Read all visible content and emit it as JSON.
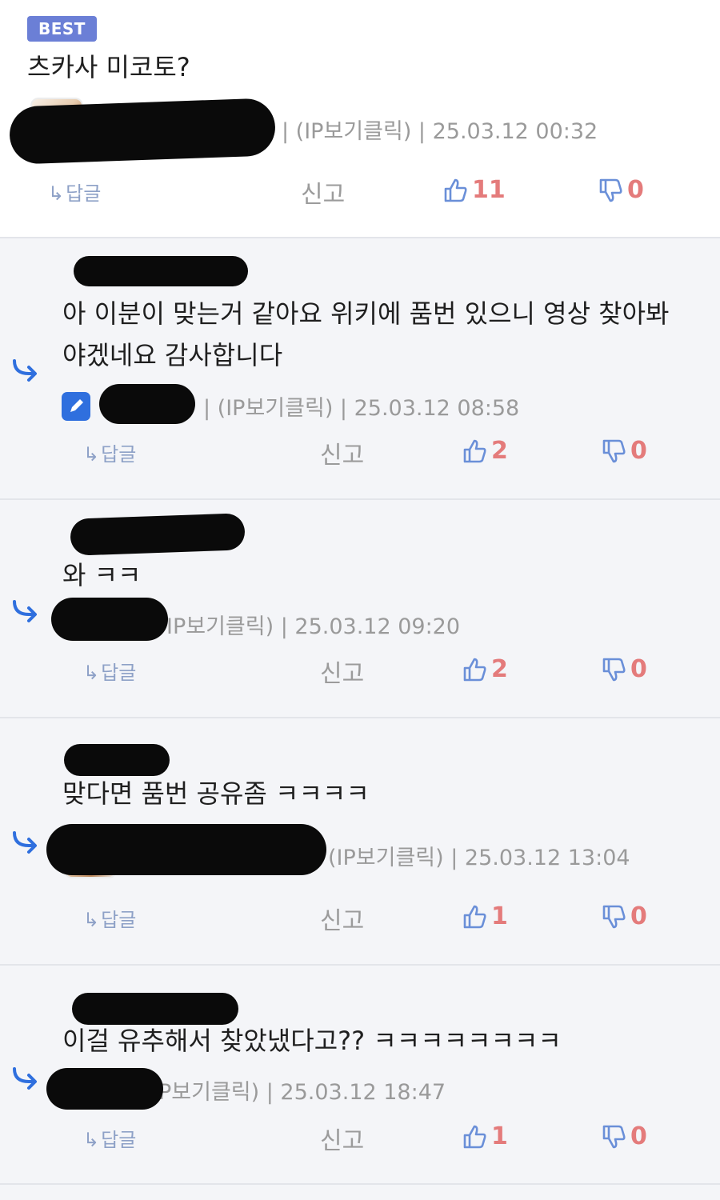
{
  "colors": {
    "accent_blue": "#2f6fde",
    "vote_number": "#e47b7b",
    "vote_icon": "#6a8fd8",
    "badge": "#6b7fd6"
  },
  "best": {
    "badge": "BEST",
    "text": "츠카사 미코토?",
    "meta": "| (IP보기클릭) | 25.03.12 00:32",
    "reply_label": "답글",
    "report_label": "신고",
    "up": "11",
    "down": "0"
  },
  "replies": [
    {
      "text": "아 이분이 맞는거 같아요 위키에 품번 있으니 영상 찾아봐\n야겠네요 감사합니다",
      "meta": "| (IP보기클릭) | 25.03.12 08:58",
      "reply_label": "답글",
      "report_label": "신고",
      "up": "2",
      "down": "0"
    },
    {
      "text": "와 ㅋㅋ",
      "meta": "IP보기클릭) | 25.03.12 09:20",
      "reply_label": "답글",
      "report_label": "신고",
      "up": "2",
      "down": "0"
    },
    {
      "text": "맞다면 품번 공유좀 ㅋㅋㅋㅋ",
      "meta": "(IP보기클릭) | 25.03.12 13:04",
      "reply_label": "답글",
      "report_label": "신고",
      "up": "1",
      "down": "0"
    },
    {
      "text": "이걸 유추해서 찾았냈다고?? ㅋㅋㅋㅋㅋㅋㅋㅋ",
      "meta": "P보기클릭) | 25.03.12 18:47",
      "reply_label": "답글",
      "report_label": "신고",
      "up": "1",
      "down": "0"
    }
  ]
}
